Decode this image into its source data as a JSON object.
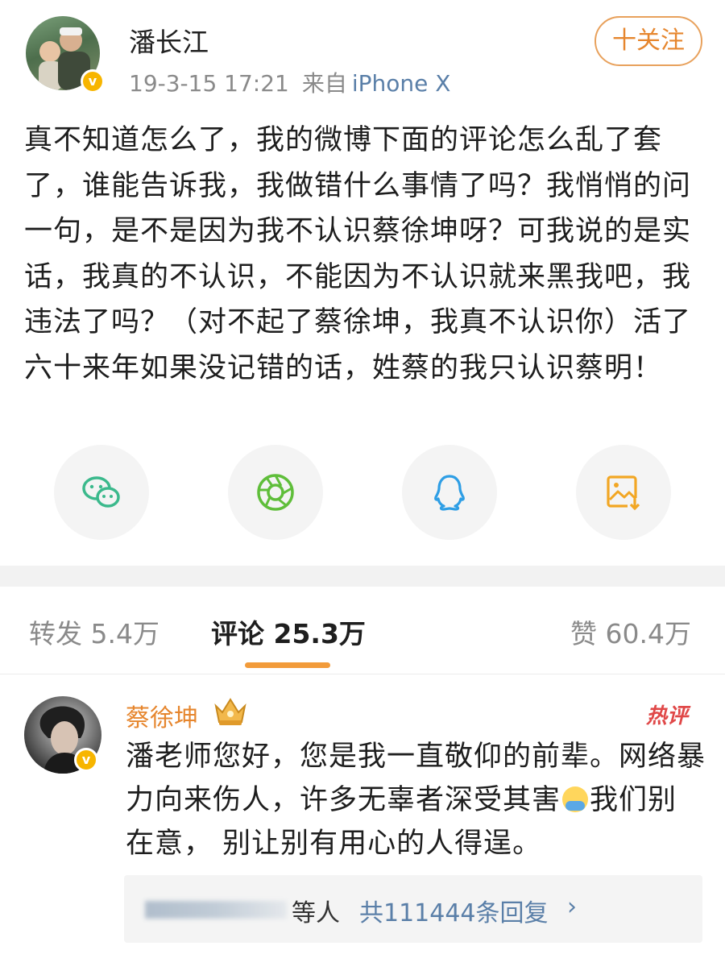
{
  "post": {
    "author": "潘长江",
    "timestamp": "19-3-15 17:21",
    "source_prefix": "来自",
    "device": "iPhone X",
    "follow_label": "十关注",
    "text": "真不知道怎么了，我的微博下面的评论怎么乱了套了，谁能告诉我，我做错什么事情了吗？我悄悄的问一句，是不是因为我不认识蔡徐坤呀？可我说的是实话，我真的不认识，不能因为不认识就来黑我吧，我违法了吗？（对不起了蔡徐坤，我真不认识你）活了六十来年如果没记错的话，姓蔡的我只认识蔡明！"
  },
  "share": {
    "icons": [
      "wechat-icon",
      "moments-icon",
      "qq-icon",
      "save-image-icon"
    ],
    "colors": {
      "wechat": "#3bb98c",
      "moments": "#5fbe3a",
      "qq": "#2e9ee5",
      "save": "#f2a623"
    }
  },
  "tabs": {
    "repost": "转发 5.4万",
    "comments": "评论 25.3万",
    "likes": "赞 60.4万"
  },
  "comment": {
    "name": "蔡徐坤",
    "hot_label": "热评",
    "text_part1": "潘老师您好，您是我一直敬仰的前辈。网络暴力向来伤人，许多无辜者深受其害",
    "text_part2": "我们别在意， 别让别有用心的人得逞。",
    "reply_etc": "等人",
    "reply_count": "共111444条回复",
    "reply_arrow": "›"
  },
  "colors": {
    "accent": "#e6862e",
    "link": "#5a7fa8",
    "verified": "#f7b500"
  }
}
